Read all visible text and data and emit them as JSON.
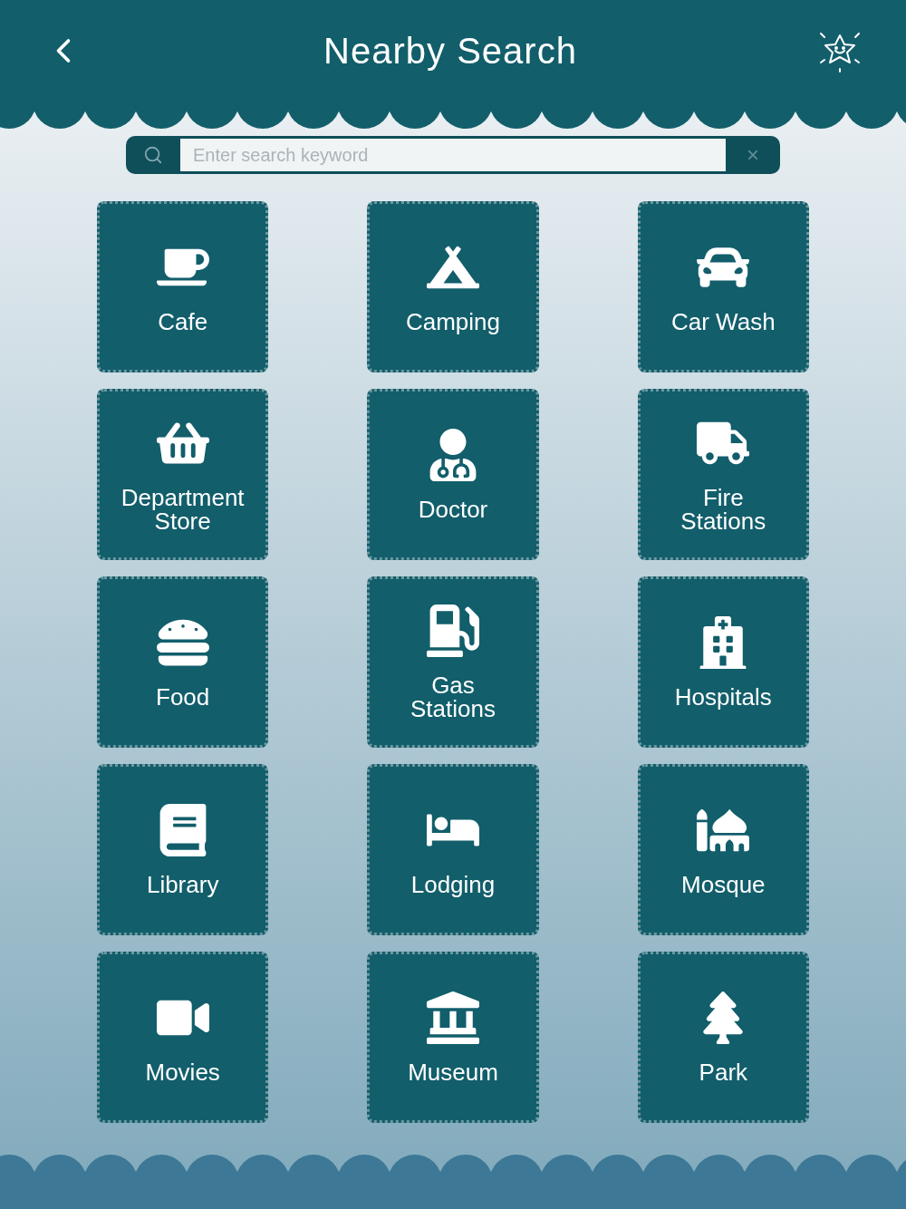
{
  "header": {
    "title": "Nearby Search"
  },
  "search": {
    "placeholder": "Enter search keyword",
    "clear_symbol": "×"
  },
  "categories": [
    {
      "label": "Cafe"
    },
    {
      "label": "Camping"
    },
    {
      "label": "Car Wash"
    },
    {
      "label": "Department\nStore"
    },
    {
      "label": "Doctor"
    },
    {
      "label": "Fire\nStations"
    },
    {
      "label": "Food"
    },
    {
      "label": "Gas\nStations"
    },
    {
      "label": "Hospitals"
    },
    {
      "label": "Library"
    },
    {
      "label": "Lodging"
    },
    {
      "label": "Mosque"
    },
    {
      "label": "Movies"
    },
    {
      "label": "Museum"
    },
    {
      "label": "Park"
    }
  ]
}
